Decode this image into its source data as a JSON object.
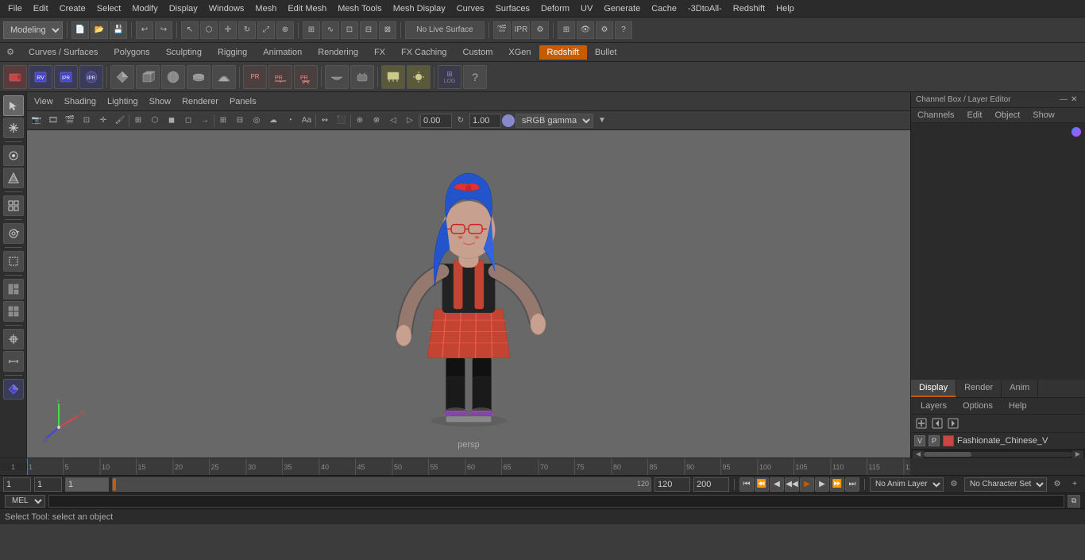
{
  "menubar": {
    "items": [
      "File",
      "Edit",
      "Create",
      "Select",
      "Modify",
      "Display",
      "Windows",
      "Mesh",
      "Edit Mesh",
      "Mesh Tools",
      "Mesh Display",
      "Curves",
      "Surfaces",
      "Deform",
      "UV",
      "Generate",
      "Cache",
      "-3DtoAll-",
      "Redshift",
      "Help"
    ]
  },
  "toolbar": {
    "workspace_label": "Modeling",
    "field_value": "No Live Surface"
  },
  "shelf_tabs": {
    "items": [
      "Curves / Surfaces",
      "Polygons",
      "Sculpting",
      "Rigging",
      "Animation",
      "Rendering",
      "FX",
      "FX Caching",
      "Custom",
      "XGen",
      "Redshift",
      "Bullet"
    ],
    "active": "Redshift"
  },
  "viewport": {
    "menus": [
      "View",
      "Shading",
      "Lighting",
      "Show",
      "Renderer",
      "Panels"
    ],
    "persp_label": "persp",
    "camera_value": "0.00",
    "scale_value": "1.00",
    "color_space": "sRGB gamma"
  },
  "right_panel": {
    "header": "Channel Box / Layer Editor",
    "tabs": [
      "Display",
      "Render",
      "Anim"
    ],
    "active_tab": "Display",
    "subtabs": [
      "Channels",
      "Edit",
      "Object",
      "Show"
    ],
    "layer_name": "Fashionate_Chinese_V",
    "layer_v": "V",
    "layer_p": "P"
  },
  "timeline": {
    "start": "1",
    "end": "120",
    "playback_end": "120",
    "range_end": "200",
    "current_frame": "1",
    "frame_field1": "1",
    "frame_field2": "1"
  },
  "bottom_controls": {
    "anim_layer": "No Anim Layer",
    "char_set": "No Character Set"
  },
  "script_bar": {
    "lang": "MEL",
    "input_value": ""
  },
  "status_bar": {
    "text": "Select Tool: select an object"
  },
  "icons": {
    "gear": "⚙",
    "undo": "↩",
    "redo": "↪",
    "move": "✛",
    "rotate": "↻",
    "scale": "⤢",
    "select": "↖",
    "lasso": "◌",
    "paint": "🖌",
    "snap": "⊞",
    "grid": "⊞",
    "play": "▶",
    "back": "◀",
    "fwd": "▶",
    "first": "⏮",
    "last": "⏭",
    "prev_key": "⏪",
    "next_key": "⏩"
  }
}
